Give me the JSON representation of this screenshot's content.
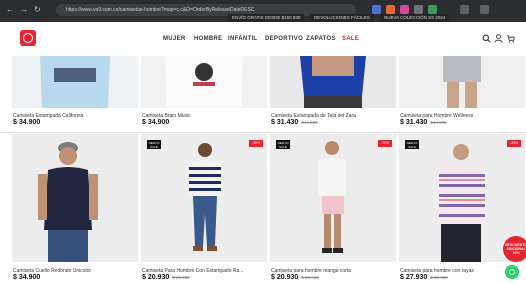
{
  "browser": {
    "url": "https://www.vo9.com.co/camisetas-hombre?map=c,c&O=OrderByReleaseDateDESC",
    "promo_items": [
      "ENVÍO GRATIS DESDE $150.000",
      "DEVOLUCIONES FÁCILES",
      "NUEVA COLECCIÓN SS 2024"
    ]
  },
  "header": {
    "menu": [
      "MUJER",
      "HOMBRE",
      "INFANTIL",
      "DEPORTIVO",
      "ZAPATOS",
      "SALE"
    ],
    "brand_color": "#e3262f"
  },
  "products_row1": [
    {
      "name": "Camiseta Estampada California",
      "price": "$ 34.900"
    },
    {
      "name": "Camiseta Brain Music",
      "price": "$ 34.900"
    },
    {
      "name": "Camiseta Estampada de Tela del Zara",
      "price": "$ 31.430",
      "old_price": "$44.900"
    },
    {
      "name": "Camiseta para Hombre Wellness",
      "price": "$ 31.430",
      "old_price": "$44.900"
    }
  ],
  "products_row2": [
    {
      "name": "Camiseta Cuello Redondo Unicolor",
      "price": "$ 34.900",
      "badge_new": "",
      "badge_off": ""
    },
    {
      "name": "Camiseta Para Hombre Con Estampado Ra...",
      "price": "$ 20.930",
      "old_price": "$ 29.900",
      "badge_new": "NEW IN SALE",
      "badge_off": "-30%"
    },
    {
      "name": "Camiseta para hombre manga corta",
      "price": "$ 20.930",
      "old_price": "$ 29.900",
      "badge_new": "NEW IN SALE",
      "badge_off": "-30%"
    },
    {
      "name": "Camiseta para hombre con rayas",
      "price": "$ 27.930",
      "old_price": "$ 39.900",
      "badge_new": "NEW IN SALE",
      "badge_off": "-30%"
    }
  ],
  "sticker": "DESCUENTO ADICIONAL 10%"
}
